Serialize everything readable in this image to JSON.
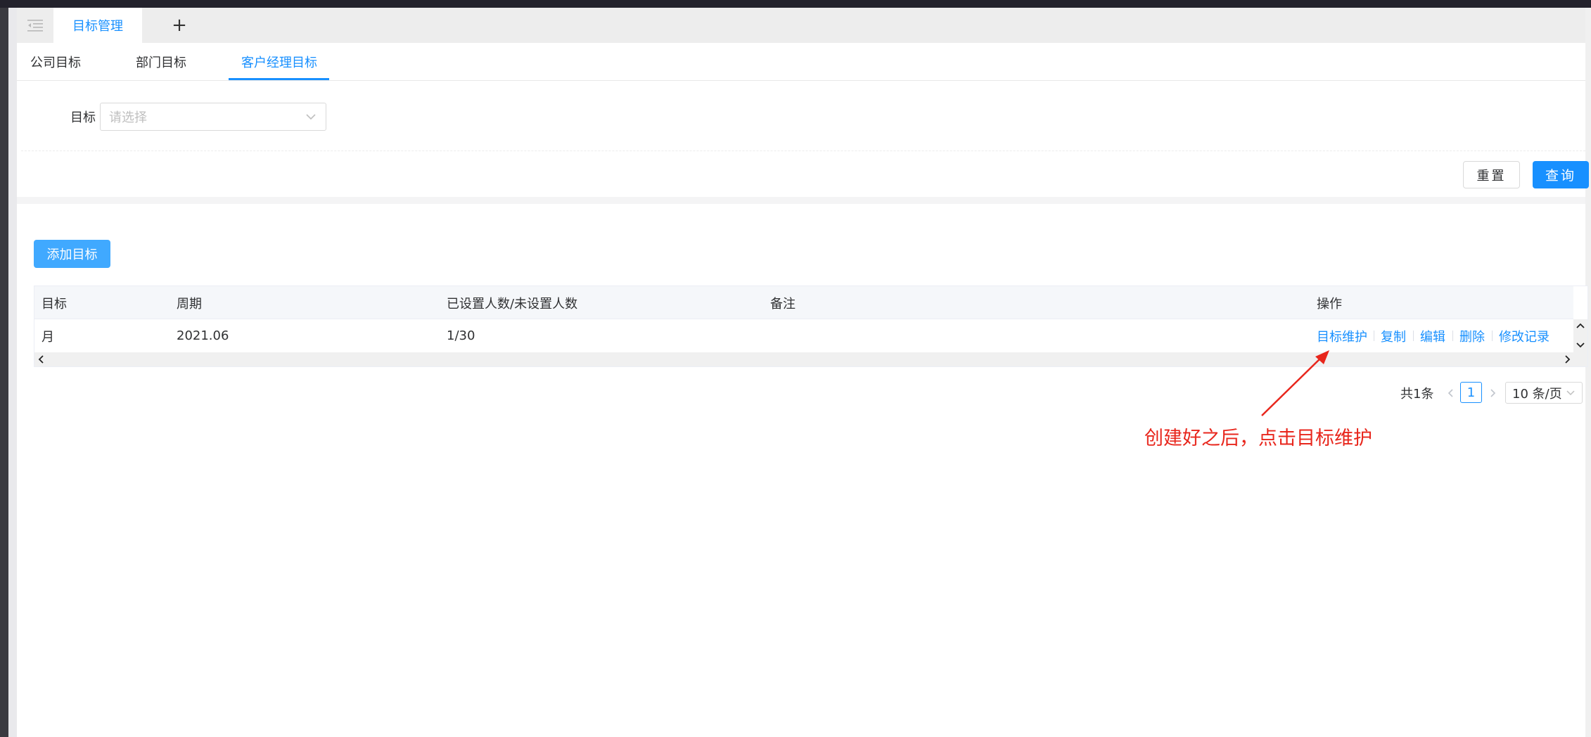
{
  "tabs": {
    "active_tab": "目标管理",
    "add_tab": "+"
  },
  "subtabs": [
    {
      "label": "公司目标"
    },
    {
      "label": "部门目标"
    },
    {
      "label": "客户经理目标"
    }
  ],
  "filter": {
    "label": "目标",
    "placeholder": "请选择"
  },
  "buttons": {
    "reset": "重置",
    "query": "查询",
    "add_target": "添加目标"
  },
  "table": {
    "columns": [
      "目标",
      "周期",
      "已设置人数/未设置人数",
      "备注",
      "操作"
    ],
    "rows": [
      {
        "target": "月",
        "period": "2021.06",
        "count": "1/30",
        "remark": ""
      }
    ],
    "actions": [
      "目标维护",
      "复制",
      "编辑",
      "删除",
      "修改记录"
    ]
  },
  "pagination": {
    "total": "共1条",
    "current_page": "1",
    "page_size": "10 条/页"
  },
  "annotation": {
    "text": "创建好之后，点击目标维护",
    "color": "#e8261c"
  },
  "colors": {
    "primary": "#1890ff",
    "add_button": "#40a9ff"
  }
}
